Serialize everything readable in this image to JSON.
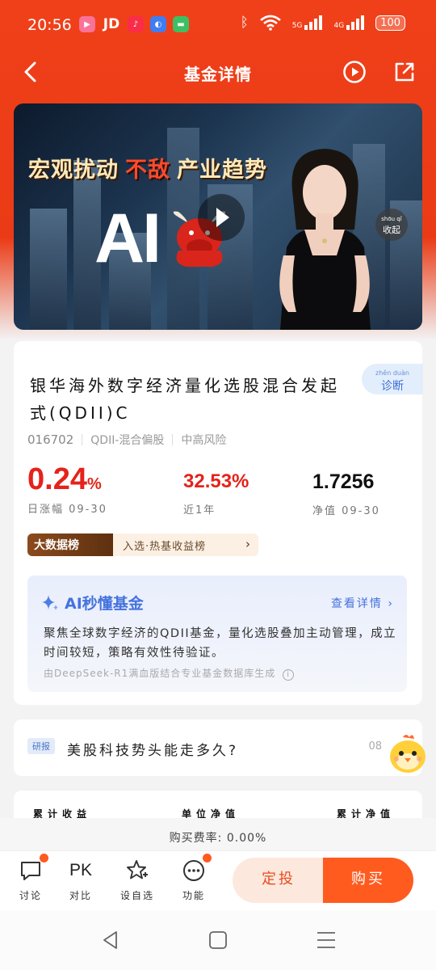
{
  "status_bar": {
    "time": "20:56",
    "apps": [
      "bilibili-icon",
      "JD",
      "music-icon",
      "browser-icon",
      "messages-icon"
    ],
    "jd_label": "JD",
    "net_5g": "5G",
    "net_4g": "4G",
    "battery": "100"
  },
  "nav": {
    "title": "基金详情"
  },
  "banner": {
    "headline_a": "宏观扰动",
    "headline_b": "不敌",
    "headline_c": "产业趋势",
    "big_text": "AI",
    "collapse_label": "收起"
  },
  "fund": {
    "name": "银华海外数字经济量化选股混合发起式(QDII)C",
    "diagnose_label": "诊断",
    "code": "016702",
    "category": "QDII-混合偏股",
    "risk": "中高风险",
    "daily_change": "0.24",
    "daily_change_unit": "%",
    "daily_change_label": "日涨幅 09-30",
    "year_return": "32.53%",
    "year_return_label": "近1年",
    "nav_value": "1.7256",
    "nav_label": "净值 09-30",
    "colors": {
      "up": "#e5221b",
      "text": "#111111"
    }
  },
  "rank": {
    "badge": "大数据榜",
    "text": "入选·热基收益榜",
    "arrow": "›"
  },
  "ai_summary": {
    "title": "AI秒懂基金",
    "more_label": "查看详情",
    "body": "聚焦全球数字经济的QDII基金，量化选股叠加主动管理，成立时间较短，策略有效性待验证。",
    "footer": "由DeepSeek-R1满血版结合专业基金数据库生成"
  },
  "research": {
    "tag": "研报",
    "text": "美股科技势头能走多久?",
    "page": "08"
  },
  "bottom_card": {
    "labels": [
      "累计收益",
      "单位净值",
      "累计净值"
    ]
  },
  "fee": {
    "text": "购买费率: 0.00%"
  },
  "toolbar": {
    "discuss_label": "讨论",
    "pk_text": "PK",
    "compare_label": "对比",
    "watchlist_label": "设自选",
    "more_label": "功能",
    "fixed_invest_label": "定投",
    "buy_label": "购买"
  },
  "colors": {
    "brand_orange": "#ea3b16",
    "buy_orange": "#ff5b1f",
    "ai_blue": "#4472dd"
  }
}
